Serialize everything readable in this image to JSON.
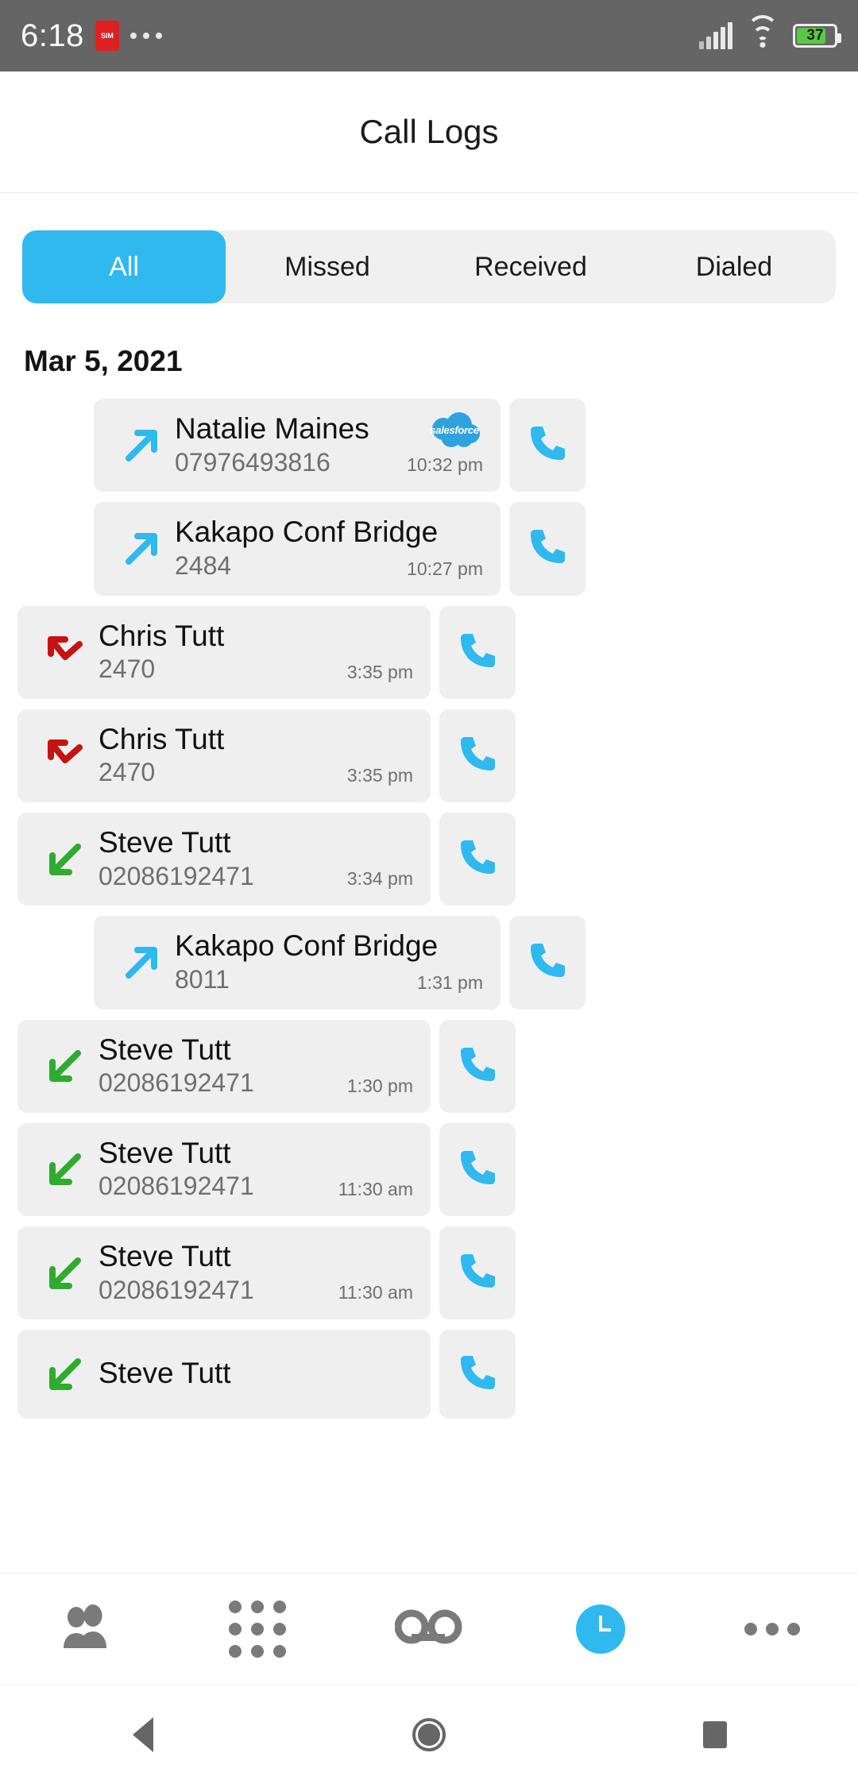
{
  "status_bar": {
    "time": "6:18",
    "badge_icon": "sim-alert-icon",
    "overflow_icon": "more-dots-icon",
    "signal_icon": "cellular-signal-icon",
    "wifi_icon": "wifi-icon",
    "battery_percent": "37",
    "battery_icon": "battery-icon"
  },
  "header": {
    "title": "Call Logs"
  },
  "tabs": [
    {
      "label": "All",
      "active": true
    },
    {
      "label": "Missed",
      "active": false
    },
    {
      "label": "Received",
      "active": false
    },
    {
      "label": "Dialed",
      "active": false
    }
  ],
  "date_section": {
    "label": "Mar 5, 2021"
  },
  "colors": {
    "accent": "#2fb9ef",
    "outgoing_arrow": "#2fb9ef",
    "incoming_arrow": "#2fab2f",
    "missed_arrow": "#c61212",
    "card_bg": "#efefef",
    "status_bar_bg": "#656565",
    "battery_fill": "#5ac846"
  },
  "calls": [
    {
      "name": "Natalie Maines",
      "number": "07976493816",
      "time": "10:32 pm",
      "direction": "outgoing",
      "badge": "salesforce",
      "badge_label": "salesforce",
      "call_icon": "phone-icon"
    },
    {
      "name": "Kakapo Conf Bridge",
      "number": "2484",
      "time": "10:27 pm",
      "direction": "outgoing",
      "badge": null,
      "badge_label": "",
      "call_icon": "phone-icon"
    },
    {
      "name": "Chris Tutt",
      "number": "2470",
      "time": "3:35 pm",
      "direction": "missed",
      "badge": null,
      "badge_label": "",
      "call_icon": "phone-icon"
    },
    {
      "name": "Chris Tutt",
      "number": "2470",
      "time": "3:35 pm",
      "direction": "missed",
      "badge": null,
      "badge_label": "",
      "call_icon": "phone-icon"
    },
    {
      "name": "Steve Tutt",
      "number": "02086192471",
      "time": "3:34 pm",
      "direction": "incoming",
      "badge": null,
      "badge_label": "",
      "call_icon": "phone-icon"
    },
    {
      "name": "Kakapo Conf Bridge",
      "number": "8011",
      "time": "1:31 pm",
      "direction": "outgoing",
      "badge": null,
      "badge_label": "",
      "call_icon": "phone-icon"
    },
    {
      "name": "Steve Tutt",
      "number": "02086192471",
      "time": "1:30 pm",
      "direction": "incoming",
      "badge": null,
      "badge_label": "",
      "call_icon": "phone-icon"
    },
    {
      "name": "Steve Tutt",
      "number": "02086192471",
      "time": "11:30 am",
      "direction": "incoming",
      "badge": null,
      "badge_label": "",
      "call_icon": "phone-icon"
    },
    {
      "name": "Steve Tutt",
      "number": "02086192471",
      "time": "11:30 am",
      "direction": "incoming",
      "badge": null,
      "badge_label": "",
      "call_icon": "phone-icon"
    },
    {
      "name": "Steve Tutt",
      "number": "",
      "time": "",
      "direction": "incoming",
      "badge": null,
      "badge_label": "",
      "call_icon": "phone-icon"
    }
  ],
  "bottom_nav": [
    {
      "icon": "contacts-icon",
      "active": false
    },
    {
      "icon": "dialpad-icon",
      "active": false
    },
    {
      "icon": "voicemail-icon",
      "active": false
    },
    {
      "icon": "call-history-clock-icon",
      "active": true
    },
    {
      "icon": "more-icon",
      "active": false
    }
  ],
  "android_nav": [
    {
      "icon": "back-icon"
    },
    {
      "icon": "home-icon"
    },
    {
      "icon": "recents-icon"
    }
  ]
}
